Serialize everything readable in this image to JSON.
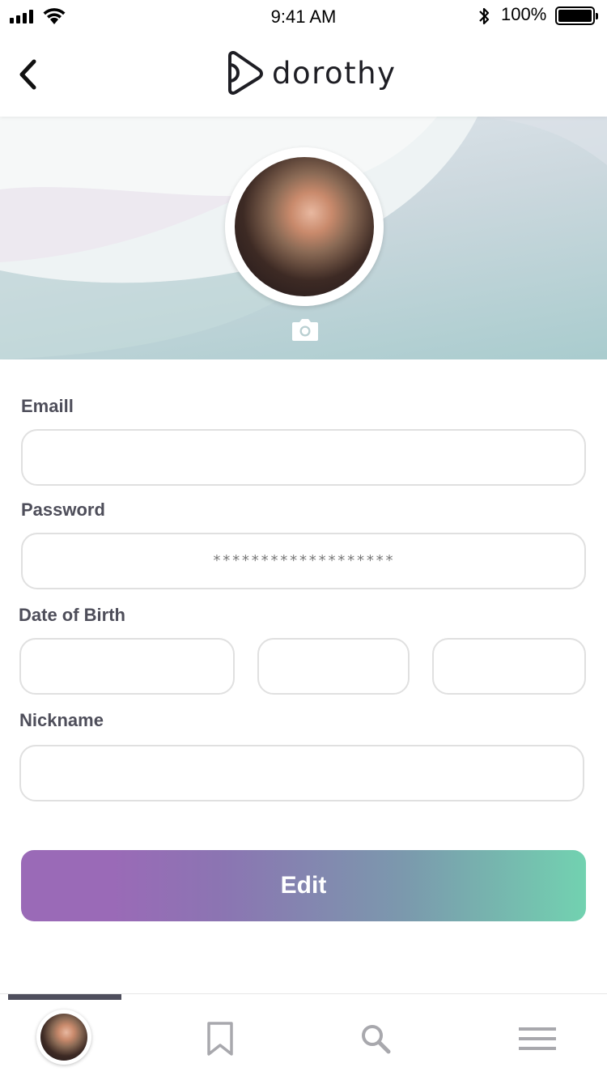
{
  "status_bar": {
    "time": "9:41 AM",
    "battery_text": "100%",
    "icons": [
      "signal-icon",
      "wifi-icon",
      "bluetooth-icon",
      "battery-icon"
    ]
  },
  "nav": {
    "back_icon": "chevron-left-icon",
    "logo_text": "dorothy",
    "logo_icon": "dorothy-logo-icon"
  },
  "profile": {
    "avatar": "profile-avatar",
    "camera_icon": "camera-icon"
  },
  "form": {
    "email": {
      "label": "Emaill",
      "value": ""
    },
    "password": {
      "label": "Password",
      "value": "*******************"
    },
    "dob": {
      "label": "Date of Birth",
      "day": "",
      "month": "",
      "year": ""
    },
    "nickname": {
      "label": "Nickname",
      "value": ""
    }
  },
  "edit_button": {
    "label": "Edit",
    "gradient_start": "#9a6ab7",
    "gradient_end": "#72d2b0"
  },
  "tabbar": {
    "active_index": 0,
    "tabs": [
      "profile-tab",
      "bookmark-icon",
      "search-icon",
      "menu-icon"
    ],
    "indicator_color": "#4f4f5d"
  }
}
